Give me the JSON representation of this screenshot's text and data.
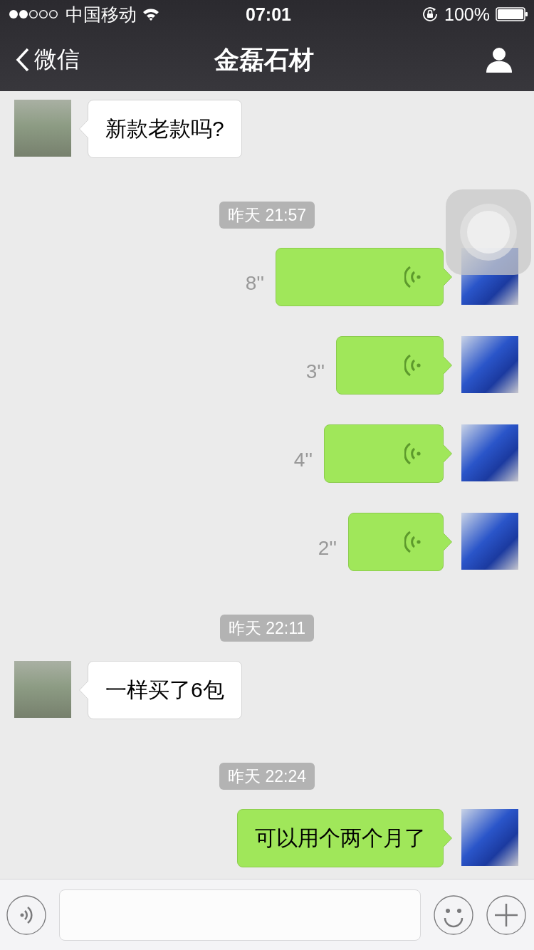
{
  "status_bar": {
    "carrier": "中国移动",
    "time": "07:01",
    "battery": "100%"
  },
  "nav": {
    "back": "微信",
    "title": "金磊石材"
  },
  "messages": [
    {
      "kind": "text",
      "outgoing": false,
      "text": "新款老款吗?"
    },
    {
      "kind": "time",
      "text": "昨天 21:57"
    },
    {
      "kind": "voice",
      "outgoing": true,
      "duration": "8''"
    },
    {
      "kind": "voice",
      "outgoing": true,
      "duration": "3''"
    },
    {
      "kind": "voice",
      "outgoing": true,
      "duration": "4''"
    },
    {
      "kind": "voice",
      "outgoing": true,
      "duration": "2''"
    },
    {
      "kind": "time",
      "text": "昨天 22:11"
    },
    {
      "kind": "text",
      "outgoing": false,
      "text": "一样买了6包"
    },
    {
      "kind": "time",
      "text": "昨天 22:24"
    },
    {
      "kind": "text",
      "outgoing": true,
      "text": "可以用个两个月了"
    }
  ]
}
